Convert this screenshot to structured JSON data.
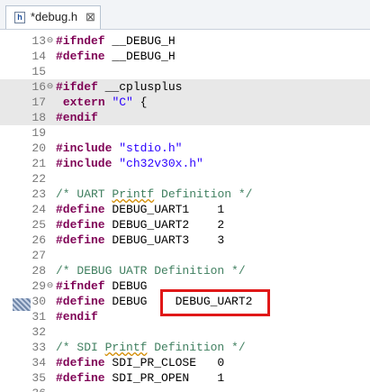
{
  "tab": {
    "title": "*debug.h",
    "close": "⊠",
    "icon_label": "h"
  },
  "lines": [
    {
      "num": "13",
      "fold": "⊖",
      "band": false,
      "tokens": [
        {
          "t": "#ifndef",
          "c": "kw"
        },
        {
          "t": " __DEBUG_H",
          "c": ""
        }
      ]
    },
    {
      "num": "14",
      "fold": "",
      "band": false,
      "tokens": [
        {
          "t": "#define",
          "c": "kw"
        },
        {
          "t": " __DEBUG_H",
          "c": ""
        }
      ]
    },
    {
      "num": "15",
      "fold": "",
      "band": false,
      "tokens": []
    },
    {
      "num": "16",
      "fold": "⊖",
      "band": true,
      "tokens": [
        {
          "t": "#ifdef",
          "c": "kw"
        },
        {
          "t": " __cplusplus",
          "c": ""
        }
      ]
    },
    {
      "num": "17",
      "fold": "",
      "band": true,
      "tokens": [
        {
          "t": " ",
          "c": ""
        },
        {
          "t": "extern",
          "c": "kw"
        },
        {
          "t": " ",
          "c": ""
        },
        {
          "t": "\"C\"",
          "c": "str"
        },
        {
          "t": " {",
          "c": ""
        }
      ]
    },
    {
      "num": "18",
      "fold": "",
      "band": true,
      "tokens": [
        {
          "t": "#endif",
          "c": "kw"
        }
      ]
    },
    {
      "num": "19",
      "fold": "",
      "band": false,
      "tokens": []
    },
    {
      "num": "20",
      "fold": "",
      "band": false,
      "tokens": [
        {
          "t": "#include",
          "c": "kw"
        },
        {
          "t": " ",
          "c": ""
        },
        {
          "t": "\"stdio.h\"",
          "c": "str"
        }
      ]
    },
    {
      "num": "21",
      "fold": "",
      "band": false,
      "tokens": [
        {
          "t": "#include",
          "c": "kw"
        },
        {
          "t": " ",
          "c": ""
        },
        {
          "t": "\"ch32v30x.h\"",
          "c": "str"
        }
      ]
    },
    {
      "num": "22",
      "fold": "",
      "band": false,
      "tokens": []
    },
    {
      "num": "23",
      "fold": "",
      "band": false,
      "tokens": [
        {
          "t": "/* UART ",
          "c": "cm"
        },
        {
          "t": "Printf",
          "c": "cm spell"
        },
        {
          "t": " Definition */",
          "c": "cm"
        }
      ]
    },
    {
      "num": "24",
      "fold": "",
      "band": false,
      "tokens": [
        {
          "t": "#define",
          "c": "kw"
        },
        {
          "t": " DEBUG_UART1    1",
          "c": ""
        }
      ]
    },
    {
      "num": "25",
      "fold": "",
      "band": false,
      "tokens": [
        {
          "t": "#define",
          "c": "kw"
        },
        {
          "t": " DEBUG_UART2    2",
          "c": ""
        }
      ]
    },
    {
      "num": "26",
      "fold": "",
      "band": false,
      "tokens": [
        {
          "t": "#define",
          "c": "kw"
        },
        {
          "t": " DEBUG_UART3    3",
          "c": ""
        }
      ]
    },
    {
      "num": "27",
      "fold": "",
      "band": false,
      "tokens": []
    },
    {
      "num": "28",
      "fold": "",
      "band": false,
      "tokens": [
        {
          "t": "/* DEBUG UATR Definition */",
          "c": "cm"
        }
      ]
    },
    {
      "num": "29",
      "fold": "⊖",
      "band": false,
      "tokens": [
        {
          "t": "#ifndef",
          "c": "kw"
        },
        {
          "t": " DEBUG",
          "c": ""
        }
      ]
    },
    {
      "num": "30",
      "fold": "",
      "band": false,
      "tokens": [
        {
          "t": "#define",
          "c": "kw"
        },
        {
          "t": " DEBUG    DEBUG_UART2",
          "c": ""
        }
      ]
    },
    {
      "num": "31",
      "fold": "",
      "band": false,
      "tokens": [
        {
          "t": "#endif",
          "c": "kw"
        }
      ]
    },
    {
      "num": "32",
      "fold": "",
      "band": false,
      "tokens": []
    },
    {
      "num": "33",
      "fold": "",
      "band": false,
      "tokens": [
        {
          "t": "/* SDI ",
          "c": "cm"
        },
        {
          "t": "Printf",
          "c": "cm spell"
        },
        {
          "t": " Definition */",
          "c": "cm"
        }
      ]
    },
    {
      "num": "34",
      "fold": "",
      "band": false,
      "tokens": [
        {
          "t": "#define",
          "c": "kw"
        },
        {
          "t": " SDI_PR_CLOSE   0",
          "c": ""
        }
      ]
    },
    {
      "num": "35",
      "fold": "",
      "band": false,
      "tokens": [
        {
          "t": "#define",
          "c": "kw"
        },
        {
          "t": " SDI_PR_OPEN    1",
          "c": ""
        }
      ]
    },
    {
      "num": "36",
      "fold": "",
      "band": false,
      "tokens": []
    }
  ],
  "colors": {
    "keyword": "#7f0055",
    "string": "#2a00ff",
    "comment": "#3f7f5f",
    "highlight_box": "#e01818"
  }
}
